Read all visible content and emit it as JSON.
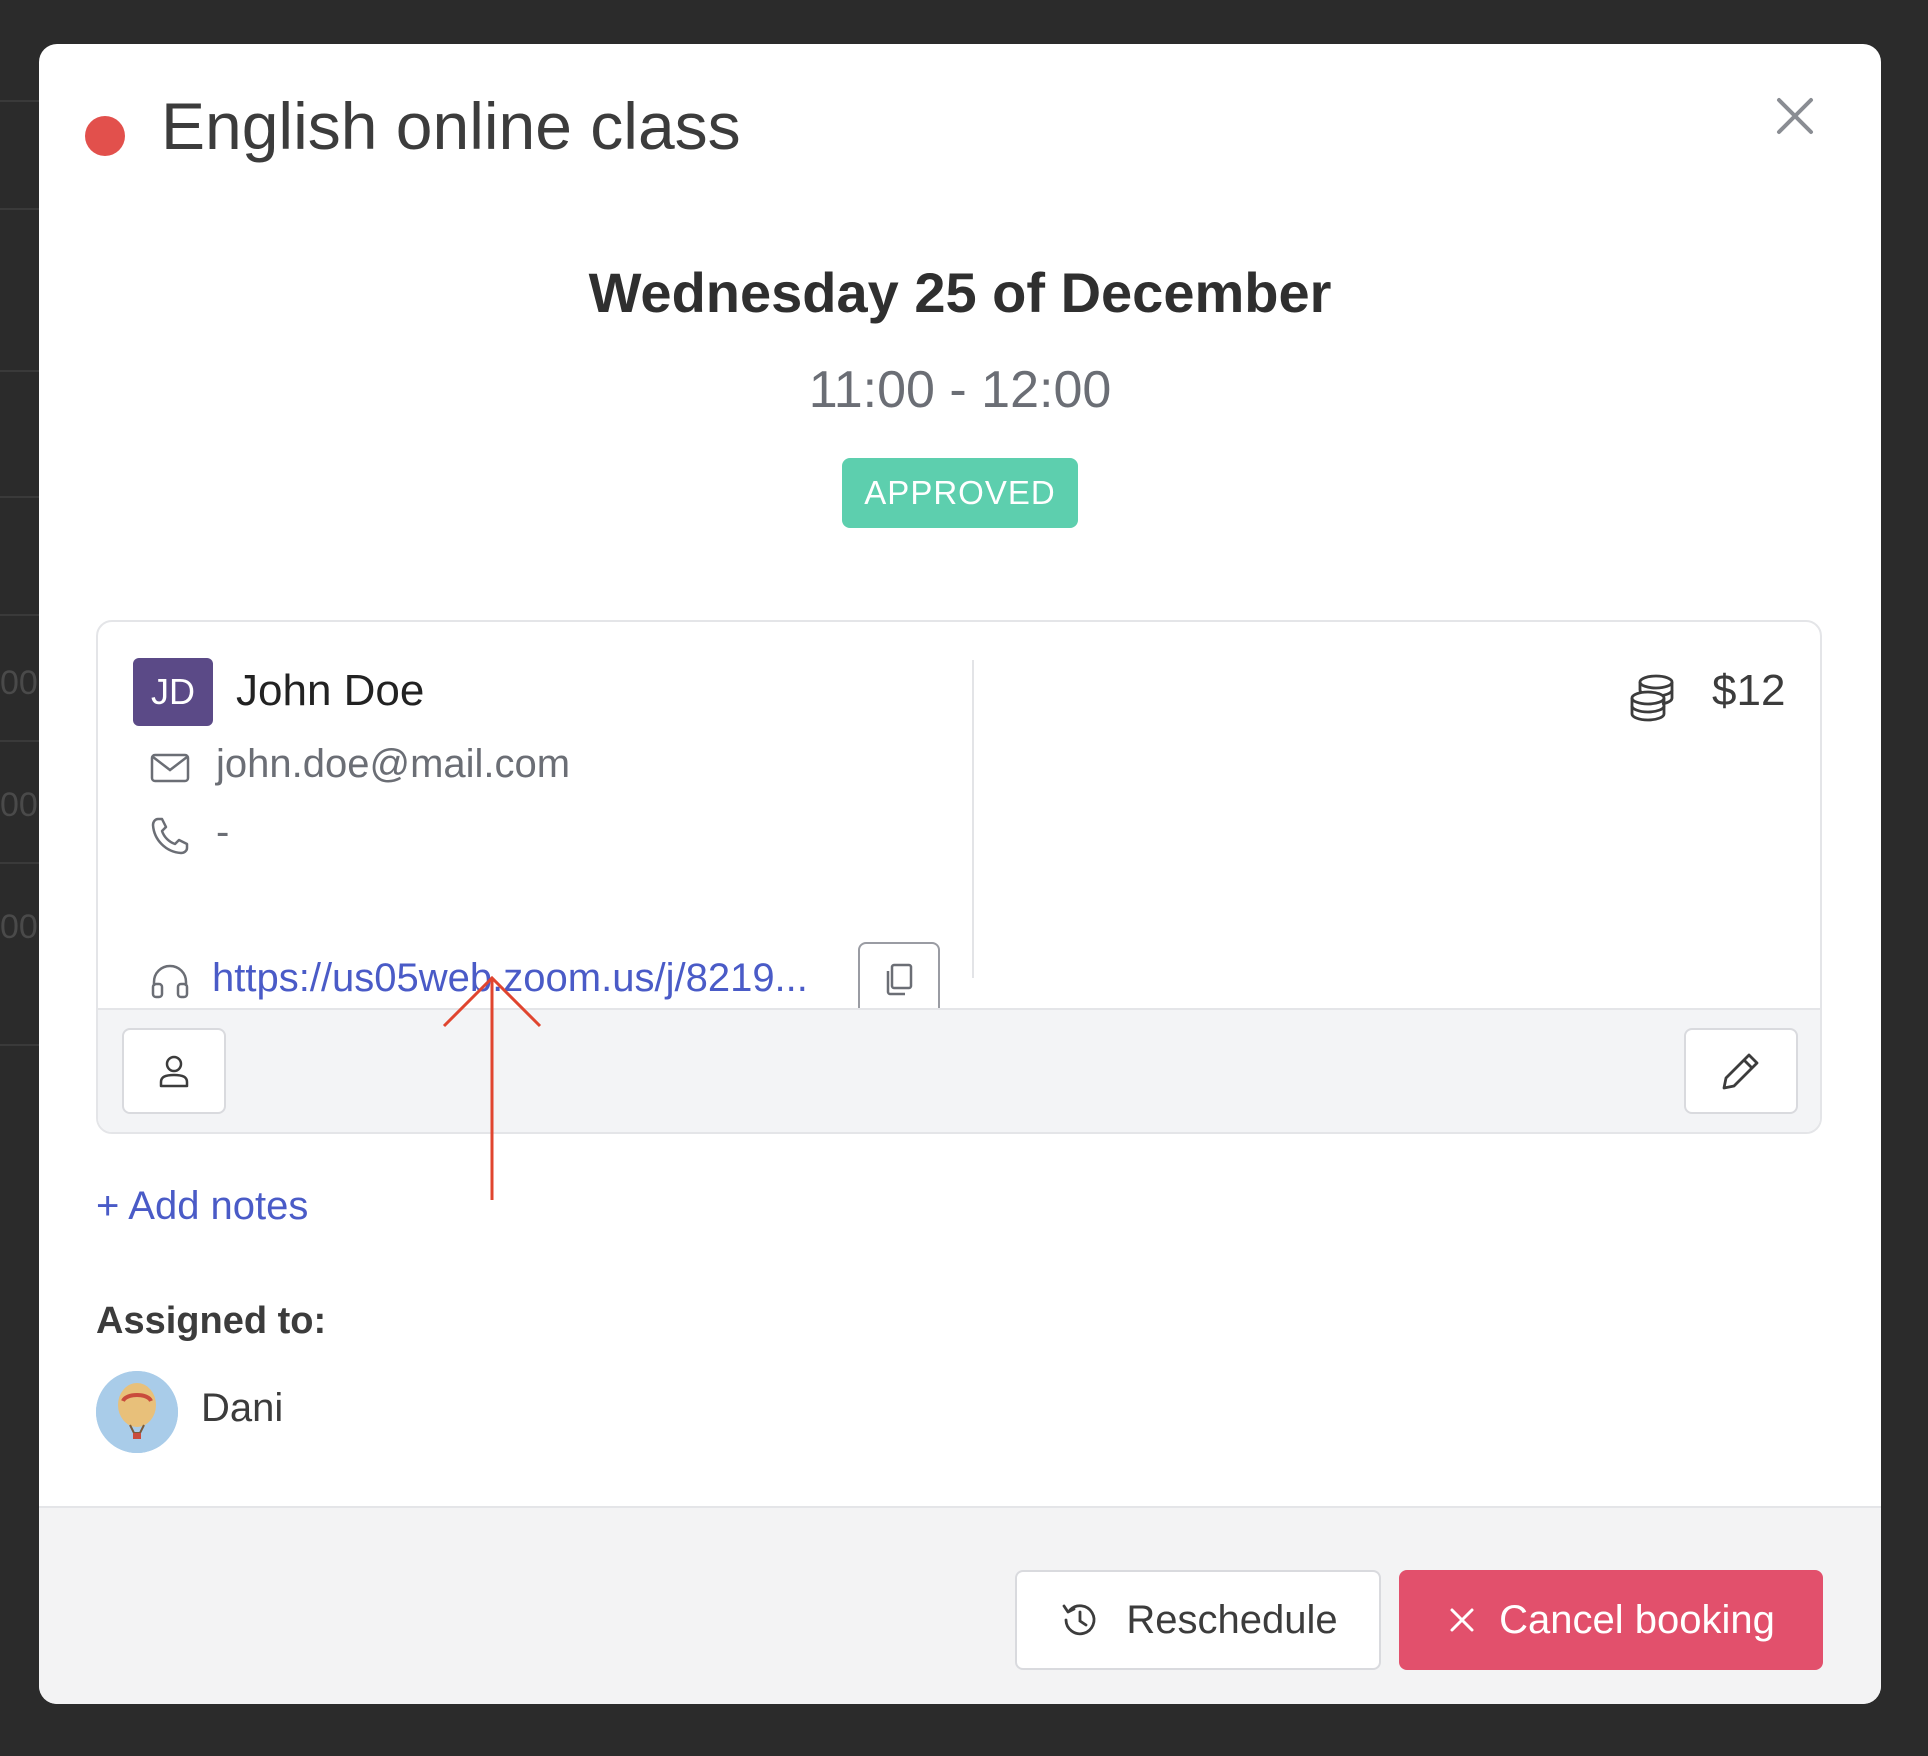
{
  "background": {
    "times": [
      "00",
      "00",
      "00"
    ]
  },
  "modal": {
    "title": "English online class",
    "status_color": "#e2504c",
    "date": "Wednesday 25 of December",
    "time_range": "11:00 - 12:00",
    "status_badge": "APPROVED",
    "badge_color": "#5dcfae"
  },
  "client": {
    "initials": "JD",
    "name": "John Doe",
    "email": "john.doe@mail.com",
    "phone": "-",
    "meeting_link": "https://us05web.zoom.us/j/8219...",
    "price": "$12"
  },
  "icons": {
    "close": "close-icon",
    "email": "mail-icon",
    "phone": "phone-icon",
    "meeting": "headset-icon",
    "copy": "copy-icon",
    "price": "coins-icon",
    "profile": "user-icon",
    "edit": "pencil-icon",
    "reschedule": "history-icon",
    "cancel": "x-icon"
  },
  "notes": {
    "add_label": "+ Add notes"
  },
  "assigned": {
    "label": "Assigned to:",
    "name": "Dani"
  },
  "footer": {
    "reschedule_label": "Reschedule",
    "cancel_label": "Cancel booking",
    "cancel_color": "#e2506c"
  }
}
